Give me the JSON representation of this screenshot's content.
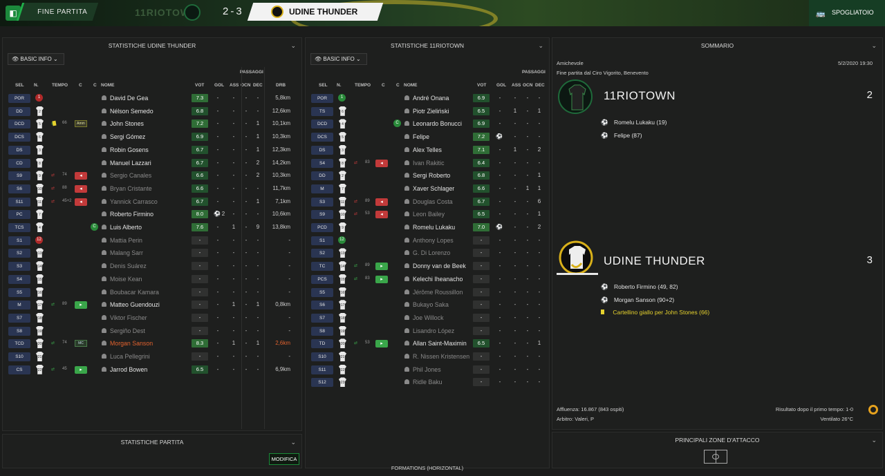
{
  "header": {
    "title": "FINE PARTITA",
    "home_team": "11RIOTOWN",
    "score": "2-3",
    "away_team": "UDINE THUNDER",
    "right_label": "SPOGLIATOIO",
    "accent": "#1c8a3c"
  },
  "left": {
    "title": "STATISTICHE UDINE THUNDER",
    "basic_info": "BASIC INFO",
    "headers": {
      "sel": "SEL",
      "n": "N.",
      "tempo": "TEMPO",
      "c1": "C",
      "c2": "C",
      "nome": "NOME",
      "vot": "VOT",
      "gol": "GOL",
      "ass": "ASS",
      "passaggi": "PASSAGGI",
      "ocn": "OCN",
      "dec": "DEC",
      "drb": "DRB"
    },
    "rows": [
      {
        "pos": "POR",
        "num": "1",
        "name": "David De Gea",
        "vot": "7.3",
        "gol": "-",
        "ass": "-",
        "ocn": "-",
        "dec": "-",
        "drb": "5,8km"
      },
      {
        "pos": "DD",
        "num": "2",
        "name": "Nélson Semedo",
        "vot": "6.8",
        "gol": "-",
        "ass": "-",
        "ocn": "-",
        "dec": "-",
        "drb": "12,6km"
      },
      {
        "pos": "DCD",
        "num": "5",
        "name": "John Stones",
        "vot": "7.2",
        "gol": "-",
        "ass": "-",
        "ocn": "-",
        "dec": "1",
        "drb": "10,1km",
        "tempo": "66",
        "badge": "Amm"
      },
      {
        "pos": "DCS",
        "num": "6",
        "name": "Sergi Gómez",
        "vot": "6.9",
        "gol": "-",
        "ass": "-",
        "ocn": "-",
        "dec": "1",
        "drb": "10,3km"
      },
      {
        "pos": "DS",
        "num": "3",
        "name": "Robin Gosens",
        "vot": "6.7",
        "gol": "-",
        "ass": "-",
        "ocn": "-",
        "dec": "1",
        "drb": "12,3km"
      },
      {
        "pos": "CD",
        "num": "8",
        "name": "Manuel Lazzari",
        "vot": "6.7",
        "gol": "-",
        "ass": "-",
        "ocn": "-",
        "dec": "2",
        "drb": "14,2km"
      },
      {
        "pos": "S9",
        "num": "9",
        "name": "Sergio Canales",
        "vot": "6.6",
        "gol": "-",
        "ass": "-",
        "ocn": "-",
        "dec": "2",
        "drb": "10,3km",
        "tempo": "74",
        "dim": true
      },
      {
        "pos": "S6",
        "num": "10",
        "name": "Bryan Cristante",
        "vot": "6.6",
        "gol": "-",
        "ass": "-",
        "ocn": "-",
        "dec": "-",
        "drb": "11,7km",
        "tempo": "88",
        "dim": true
      },
      {
        "pos": "S11",
        "num": "11",
        "name": "Yannick Carrasco",
        "vot": "6.7",
        "gol": "-",
        "ass": "-",
        "ocn": "-",
        "dec": "1",
        "drb": "7,1km",
        "tempo": "45+2",
        "dim": true
      },
      {
        "pos": "PC",
        "num": "7",
        "name": "Roberto Firmino",
        "vot": "8.0",
        "gol": "2",
        "ass": "-",
        "ocn": "-",
        "dec": "-",
        "drb": "10,6km"
      },
      {
        "pos": "TCS",
        "num": "4",
        "name": "Luis Alberto",
        "vot": "7.6",
        "gol": "-",
        "ass": "1",
        "ocn": "-",
        "dec": "9",
        "drb": "13,8km"
      },
      {
        "pos": "S1",
        "num": "12",
        "name": "Mattia Perin",
        "vot": "-",
        "gol": "-",
        "ass": "-",
        "ocn": "-",
        "dec": "-",
        "drb": "-",
        "dim": true
      },
      {
        "pos": "S2",
        "num": "13",
        "name": "Malang Sarr",
        "vot": "-",
        "gol": "-",
        "ass": "-",
        "ocn": "-",
        "dec": "-",
        "drb": "-",
        "dim": true
      },
      {
        "pos": "S3",
        "num": "14",
        "name": "Denis Suárez",
        "vot": "-",
        "gol": "-",
        "ass": "-",
        "ocn": "-",
        "dec": "-",
        "drb": "-",
        "dim": true
      },
      {
        "pos": "S4",
        "num": "15",
        "name": "Moise Kean",
        "vot": "-",
        "gol": "-",
        "ass": "-",
        "ocn": "-",
        "dec": "-",
        "drb": "-",
        "dim": true
      },
      {
        "pos": "S5",
        "num": "16",
        "name": "Boubacar Kamara",
        "vot": "-",
        "gol": "-",
        "ass": "-",
        "ocn": "-",
        "dec": "-",
        "drb": "-",
        "dim": true
      },
      {
        "pos": "M",
        "num": "17",
        "name": "Matteo Guendouzi",
        "vot": "-",
        "gol": "-",
        "ass": "1",
        "ocn": "-",
        "dec": "1",
        "drb": "0,8km",
        "tempo": "89"
      },
      {
        "pos": "S7",
        "num": "18",
        "name": "Viktor Fischer",
        "vot": "-",
        "gol": "-",
        "ass": "-",
        "ocn": "-",
        "dec": "-",
        "drb": "-",
        "dim": true
      },
      {
        "pos": "S8",
        "num": "19",
        "name": "Sergiño Dest",
        "vot": "-",
        "gol": "-",
        "ass": "-",
        "ocn": "-",
        "dec": "-",
        "drb": "-",
        "dim": true
      },
      {
        "pos": "TCD",
        "num": "20",
        "name": "Morgan Sanson",
        "vot": "8.3",
        "gol": "-",
        "ass": "1",
        "ocn": "-",
        "dec": "1",
        "drb": "2,6km",
        "tempo": "74",
        "badge": "MC",
        "red": true
      },
      {
        "pos": "S10",
        "num": "21",
        "name": "Luca Pellegrini",
        "vot": "-",
        "gol": "-",
        "ass": "-",
        "ocn": "-",
        "dec": "-",
        "drb": "-",
        "dim": true
      },
      {
        "pos": "CS",
        "num": "22",
        "name": "Jarrod Bowen",
        "vot": "6.5",
        "gol": "-",
        "ass": "-",
        "ocn": "-",
        "dec": "-",
        "drb": "6,9km",
        "tempo": "45"
      }
    ],
    "match_stats_title": "STATISTICHE PARTITA",
    "modifica": "MODIFICA"
  },
  "mid": {
    "title": "STATISTICHE 11RIOTOWN",
    "basic_info": "BASIC INFO",
    "rows": [
      {
        "pos": "POR",
        "num": "1",
        "name": "André Onana",
        "vot": "6.9",
        "gol": "-",
        "ass": "-",
        "ocn": "-",
        "dec": "-"
      },
      {
        "pos": "TS",
        "num": "6",
        "name": "Piotr Zieliński",
        "vot": "6.5",
        "gol": "-",
        "ass": "1",
        "ocn": "-",
        "dec": "1"
      },
      {
        "pos": "DCD",
        "num": "4",
        "name": "Leonardo Bonucci",
        "vot": "6.9",
        "gol": "-",
        "ass": "-",
        "ocn": "-",
        "dec": "-"
      },
      {
        "pos": "DCS",
        "num": "5",
        "name": "Felipe",
        "vot": "7.2",
        "gol": "1",
        "ass": "-",
        "ocn": "-",
        "dec": "-"
      },
      {
        "pos": "DS",
        "num": "3",
        "name": "Alex Telles",
        "vot": "7.1",
        "gol": "-",
        "ass": "1",
        "ocn": "-",
        "dec": "2"
      },
      {
        "pos": "S4",
        "num": "8",
        "name": "Ivan Rakitic",
        "vot": "6.4",
        "gol": "-",
        "ass": "-",
        "ocn": "-",
        "dec": "-",
        "tempo": "83",
        "dim": true
      },
      {
        "pos": "DD",
        "num": "2",
        "name": "Sergi Roberto",
        "vot": "6.8",
        "gol": "-",
        "ass": "-",
        "ocn": "-",
        "dec": "1"
      },
      {
        "pos": "M",
        "num": "7",
        "name": "Xaver Schlager",
        "vot": "6.6",
        "gol": "-",
        "ass": "-",
        "ocn": "1",
        "dec": "1"
      },
      {
        "pos": "S3",
        "num": "11",
        "name": "Douglas Costa",
        "vot": "6.7",
        "gol": "-",
        "ass": "-",
        "ocn": "-",
        "dec": "6",
        "tempo": "89",
        "dim": true
      },
      {
        "pos": "S9",
        "num": "10",
        "name": "Leon Bailey",
        "vot": "6.5",
        "gol": "-",
        "ass": "-",
        "ocn": "-",
        "dec": "1",
        "tempo": "53",
        "dim": true
      },
      {
        "pos": "PCD",
        "num": "9",
        "name": "Romelu Lukaku",
        "vot": "7.0",
        "gol": "1",
        "ass": "-",
        "ocn": "-",
        "dec": "2"
      },
      {
        "pos": "S1",
        "num": "12",
        "name": "Anthony Lopes",
        "vot": "-",
        "gol": "-",
        "ass": "-",
        "ocn": "-",
        "dec": "-",
        "dim": true
      },
      {
        "pos": "S2",
        "num": "13",
        "name": "G. Di Lorenzo",
        "vot": "-",
        "gol": "-",
        "ass": "-",
        "ocn": "-",
        "dec": "-",
        "dim": true
      },
      {
        "pos": "TC",
        "num": "14",
        "name": "Donny van de Beek",
        "vot": "-",
        "gol": "-",
        "ass": "-",
        "ocn": "-",
        "dec": "-",
        "tempo": "89"
      },
      {
        "pos": "PCS",
        "num": "15",
        "name": "Kelechi Iheanacho",
        "vot": "-",
        "gol": "-",
        "ass": "-",
        "ocn": "-",
        "dec": "-",
        "tempo": "83"
      },
      {
        "pos": "S5",
        "num": "16",
        "name": "Jérôme Roussillon",
        "vot": "-",
        "gol": "-",
        "ass": "-",
        "ocn": "-",
        "dec": "-",
        "dim": true
      },
      {
        "pos": "S6",
        "num": "17",
        "name": "Bukayo Saka",
        "vot": "-",
        "gol": "-",
        "ass": "-",
        "ocn": "-",
        "dec": "-",
        "dim": true
      },
      {
        "pos": "S7",
        "num": "18",
        "name": "Joe Willock",
        "vot": "-",
        "gol": "-",
        "ass": "-",
        "ocn": "-",
        "dec": "-",
        "dim": true
      },
      {
        "pos": "S8",
        "num": "19",
        "name": "Lisandro López",
        "vot": "-",
        "gol": "-",
        "ass": "-",
        "ocn": "-",
        "dec": "-",
        "dim": true
      },
      {
        "pos": "TD",
        "num": "20",
        "name": "Allan Saint-Maximin",
        "vot": "6.5",
        "gol": "-",
        "ass": "-",
        "ocn": "-",
        "dec": "1",
        "tempo": "53"
      },
      {
        "pos": "S10",
        "num": "21",
        "name": "R. Nissen Kristensen",
        "vot": "-",
        "gol": "-",
        "ass": "-",
        "ocn": "-",
        "dec": "-",
        "dim": true
      },
      {
        "pos": "S11",
        "num": "22",
        "name": "Phil Jones",
        "vot": "-",
        "gol": "-",
        "ass": "-",
        "ocn": "-",
        "dec": "-",
        "dim": true
      },
      {
        "pos": "S12",
        "num": "23",
        "name": "Ridle Baku",
        "vot": "-",
        "gol": "-",
        "ass": "-",
        "ocn": "-",
        "dec": "-",
        "dim": true
      }
    ],
    "formations_title": "FORMATIONS (HORIZONTAL)"
  },
  "right": {
    "title": "SOMMARIO",
    "competition": "Amichevole",
    "datetime": "5/2/2020 19:30",
    "venue": "Fine partita dal Ciro Vigorito, Benevento",
    "home_team": "11RIOTOWN",
    "home_score": "2",
    "home_events": [
      "Romelu Lukaku (19)",
      "Felipe (87)"
    ],
    "away_team": "UDINE THUNDER",
    "away_score": "3",
    "away_events": [
      "Roberto Firmino (49, 82)",
      "Morgan Sanson (90+2)"
    ],
    "away_card": "Cartellino giallo per John Stones (66)",
    "attendance": "Affluenza: 16.867 (843 ospiti)",
    "referee": "Arbitro: Valeri, P",
    "halftime": "Risultato dopo il primo tempo: 1-0",
    "weather": "Ventilato 26°C",
    "attack_title": "PRINCIPALI ZONE D'ATTACCO"
  }
}
